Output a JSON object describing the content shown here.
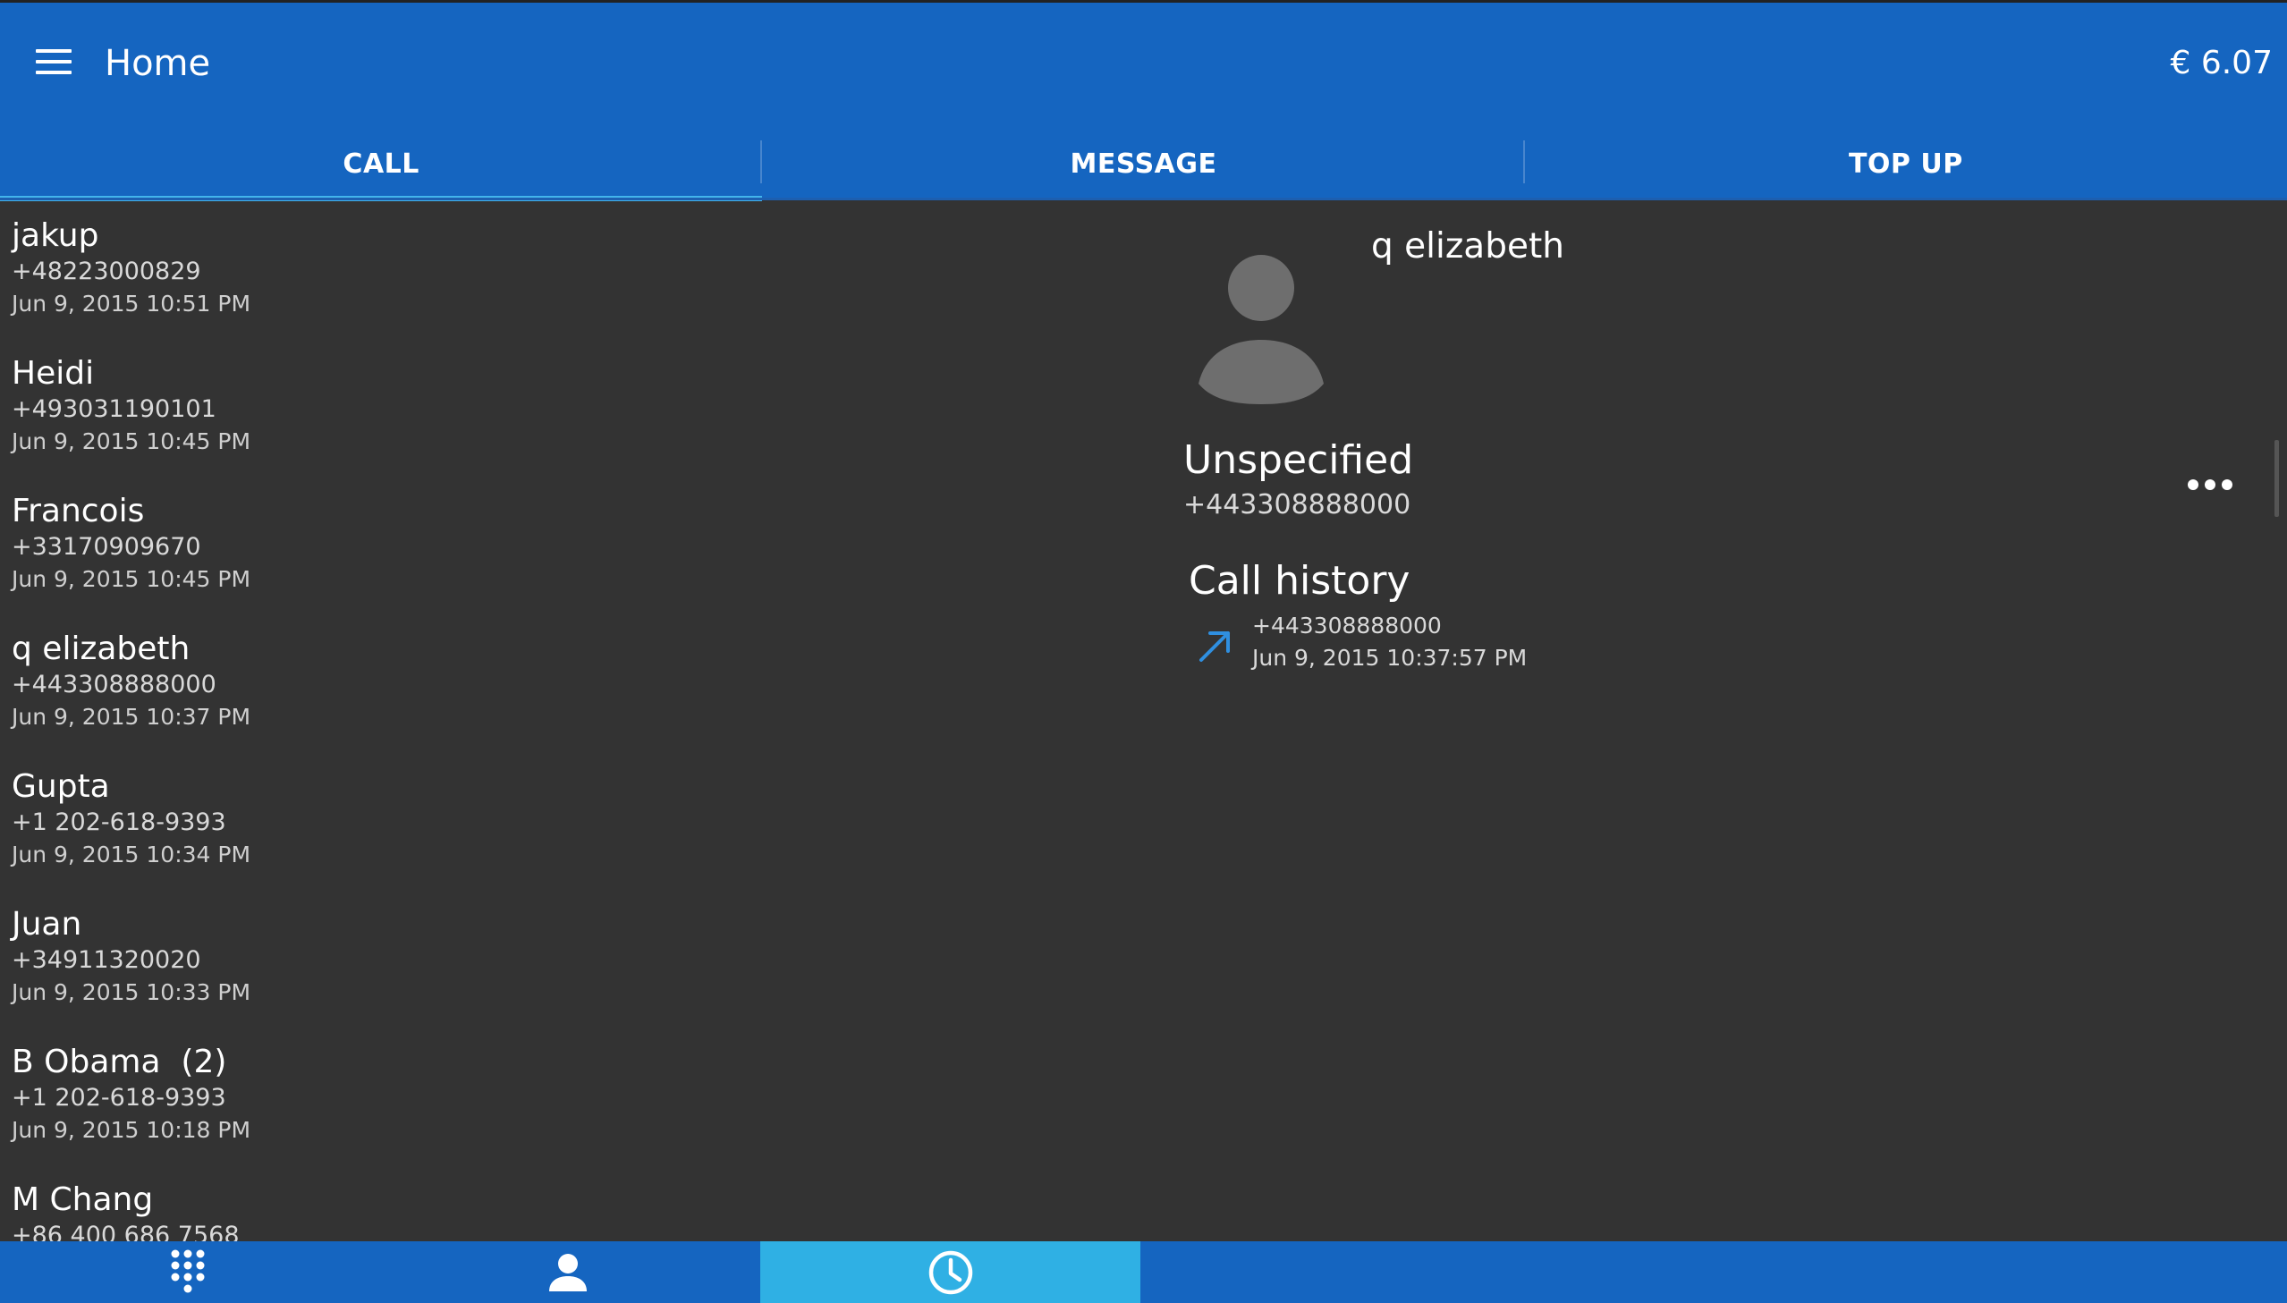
{
  "appbar": {
    "title": "Home",
    "balance": "€ 6.07",
    "menu_icon": "hamburger-menu-icon"
  },
  "tabs": [
    {
      "label": "CALL",
      "selected": true
    },
    {
      "label": "MESSAGE",
      "selected": false
    },
    {
      "label": "TOP UP",
      "selected": false
    }
  ],
  "calls": [
    {
      "name": "jakup",
      "number": "+48223000829",
      "date": "Jun 9, 2015 10:51 PM"
    },
    {
      "name": "Heidi",
      "number": "+493031190101",
      "date": "Jun 9, 2015 10:45 PM"
    },
    {
      "name": "Francois",
      "number": "+33170909670",
      "date": "Jun 9, 2015 10:45 PM"
    },
    {
      "name": "q elizabeth",
      "number": "+443308888000",
      "date": "Jun 9, 2015 10:37 PM"
    },
    {
      "name": "Gupta",
      "number": "+1 202-618-9393",
      "date": "Jun 9, 2015 10:34 PM"
    },
    {
      "name": "Juan",
      "number": "+34911320020",
      "date": "Jun 9, 2015 10:33 PM"
    },
    {
      "name": "B Obama  (2)",
      "number": "+1 202-618-9393",
      "date": "Jun 9, 2015 10:18 PM"
    },
    {
      "name": "M Chang",
      "number": "+86 400 686 7568",
      "date": ""
    }
  ],
  "detail": {
    "contact_name": "q elizabeth",
    "avatar_icon": "person-avatar-icon",
    "number_type": "Unspecified",
    "number": "+443308888000",
    "more_icon": "more-horizontal-icon",
    "history_title": "Call history",
    "history": [
      {
        "direction_icon": "outgoing-call-arrow-icon",
        "number": "+443308888000",
        "date": "Jun 9, 2015 10:37:57 PM"
      }
    ]
  },
  "bottom_nav": [
    {
      "icon": "dialpad-icon",
      "active": false
    },
    {
      "icon": "contacts-icon",
      "active": false
    },
    {
      "icon": "recent-calls-clock-icon",
      "active": true
    }
  ],
  "colors": {
    "primary": "#1565c0",
    "background": "#333333",
    "accent": "#2fb0e4",
    "tab_indicator": "#42b4ec",
    "call_arrow": "#2f8fe0"
  }
}
